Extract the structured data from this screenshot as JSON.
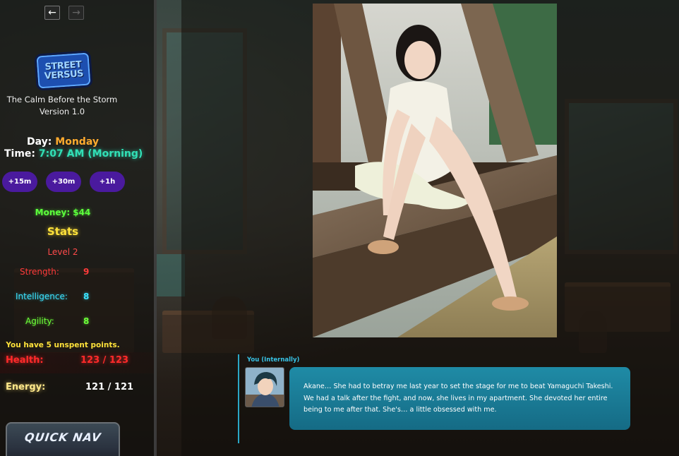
{
  "nav": {
    "back_glyph": "←",
    "forward_glyph": "→"
  },
  "game": {
    "logo_line1": "STREET",
    "logo_line2": "VERSUS",
    "title": "The Calm Before the Storm",
    "version": "Version 1.0"
  },
  "status": {
    "day_label": "Day:",
    "day_value": "Monday",
    "time_label": "Time:",
    "time_value": "7:07 AM (Morning)"
  },
  "time_buttons": [
    "+15m",
    "+30m",
    "+1h"
  ],
  "money": "Money: $44",
  "stats": {
    "heading": "Stats",
    "level": "Level 2",
    "strength_label": "Strength:",
    "strength_value": "9",
    "intelligence_label": "Intelligence:",
    "intelligence_value": "8",
    "agility_label": "Agility:",
    "agility_value": "8",
    "unspent": "You have 5 unspent points."
  },
  "vitals": {
    "health_label": "Health:",
    "health_value": "123 / 123",
    "energy_label": "Energy:",
    "energy_value": "121 / 121"
  },
  "quick_nav_label": "QUICK NAV",
  "dialogue": {
    "speaker": "You (Internally)",
    "text": "Akane… She had to betray me last year to set the stage for me to beat Yamaguchi Takeshi. We had a talk after the fight, and now, she lives in my apartment. She devoted her entire being to me after that. She's… a little obsessed with me."
  },
  "colors": {
    "accent_teal": "#31e0b6",
    "accent_orange": "#ffab2e",
    "button_purple": "#4a1a9e",
    "dialogue_bg": "#1f8ba6",
    "health_red": "#ff2a2a",
    "money_green": "#5cff3c",
    "stats_yellow": "#ffe23a"
  }
}
